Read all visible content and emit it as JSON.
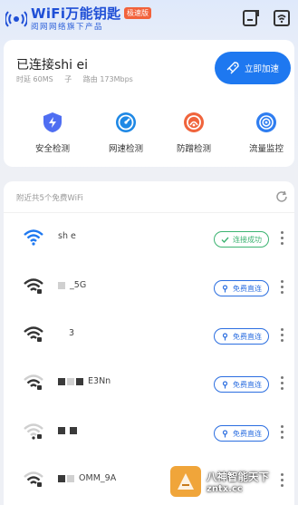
{
  "header": {
    "app_title": "WiFi万能钥匙",
    "badge": "极速版",
    "slogan": "阅网网络旗下产品",
    "logo_icon": "wifi-key-logo-icon",
    "scan_icon": "scan-icon",
    "share_icon": "wifi-share-icon"
  },
  "status": {
    "title": "已连接shi     ei",
    "latency": "时延 60MS",
    "extra": "子",
    "speed": "路由 173Mbps",
    "boost_label": "立即加速"
  },
  "tools": [
    {
      "label": "安全检测",
      "icon": "shield-lightning-icon",
      "color": "#4f6ef2"
    },
    {
      "label": "网速检测",
      "icon": "speedometer-icon",
      "color": "#1e88e5"
    },
    {
      "label": "防蹭检测",
      "icon": "anti-leech-icon",
      "color": "#f0643c"
    },
    {
      "label": "流量监控",
      "icon": "signal-monitor-icon",
      "color": "#2e7df0"
    }
  ],
  "list": {
    "header": "附近共5个免费WiFi",
    "networks": [
      {
        "ssid": "sh       e",
        "action": "连接成功",
        "state": "connected",
        "signal": 4
      },
      {
        "ssid": "  _5G",
        "action": "免费直连",
        "state": "free",
        "signal": 4
      },
      {
        "ssid": "3",
        "action": "免费直连",
        "state": "free",
        "signal": 4
      },
      {
        "ssid": "E3Nn",
        "action": "免费直连",
        "state": "free",
        "signal": 3
      },
      {
        "ssid": "",
        "action": "免费直连",
        "state": "free",
        "signal": 1
      },
      {
        "ssid": "OMM_9A",
        "action": "免费直连",
        "state": "free",
        "signal": 3
      }
    ]
  },
  "watermark": {
    "title": "八神智能天下",
    "url": "zntx.cc"
  },
  "colors": {
    "accent": "#1e78f0",
    "connected": "#3cb371",
    "free": "#2b6ee0"
  }
}
